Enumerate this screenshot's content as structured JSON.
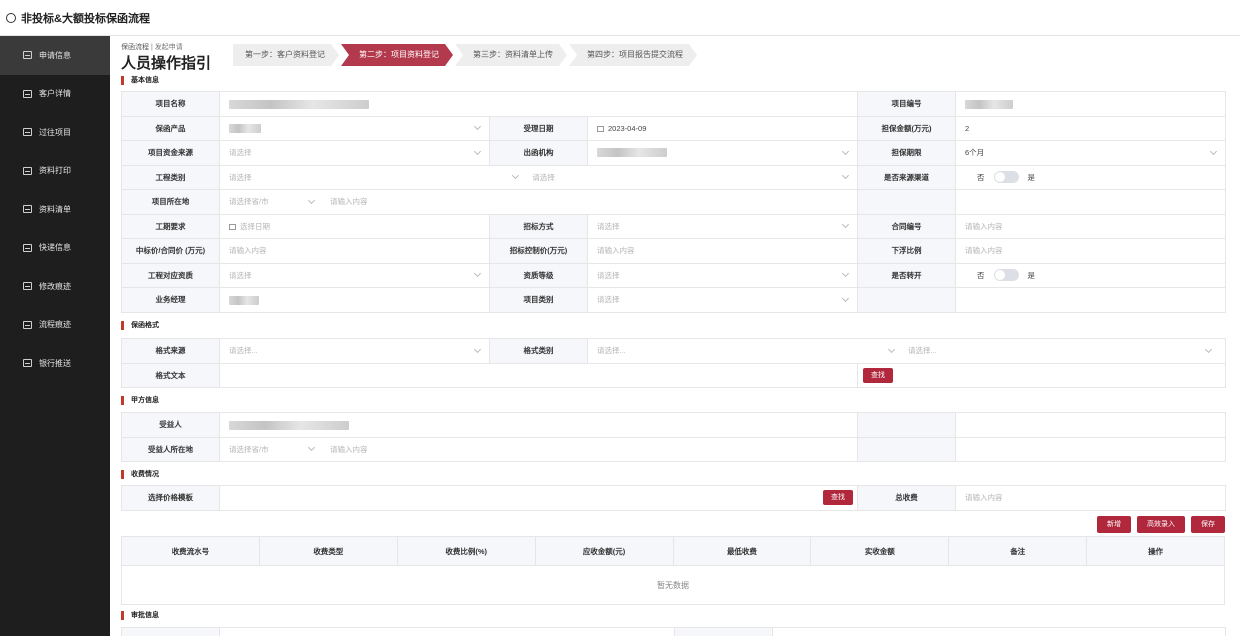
{
  "app": {
    "title": "非投标&大额投标保函流程"
  },
  "sidebar": {
    "items": [
      {
        "label": "申请信息",
        "active": true
      },
      {
        "label": "客户详情"
      },
      {
        "label": "过往项目"
      },
      {
        "label": "资料打印"
      },
      {
        "label": "资料清单"
      },
      {
        "label": "快递信息"
      },
      {
        "label": "修改痕迹"
      },
      {
        "label": "流程痕迹"
      },
      {
        "label": "银行推送"
      }
    ]
  },
  "breadcrumb": {
    "part1": "保函流程",
    "sep": "|",
    "part2": "发起申请"
  },
  "page_title": "人员操作指引",
  "steps": [
    {
      "label": "第一步：客户资料登记"
    },
    {
      "label": "第二步：项目资料登记",
      "active": true
    },
    {
      "label": "第三步：资料清单上传"
    },
    {
      "label": "第四步：项目报告提交流程"
    }
  ],
  "sections": {
    "basic": "基本信息",
    "format": "保函格式",
    "party": "甲方信息",
    "fee": "收费情况",
    "approval": "审批信息"
  },
  "basic": {
    "project_name_label": "项目名称",
    "project_no_label": "项目编号",
    "product_label": "保函产品",
    "accept_date_label": "受理日期",
    "accept_date": "2023-04-09",
    "guarantee_amount_label": "担保金额(万元)",
    "guarantee_amount": "2",
    "fund_source_label": "项目资金来源",
    "fund_source_ph": "请选择",
    "issuer_label": "出函机构",
    "guarantee_period_label": "担保期限",
    "guarantee_period": "6个月",
    "eng_type_label": "工程类别",
    "eng_type_ph1": "请选择",
    "eng_type_ph2": "请选择",
    "source_channel_label": "是否来源渠道",
    "no": "否",
    "yes": "是",
    "location_label": "项目所在地",
    "province_ph": "请选择省/市",
    "detail_ph": "请输入内容",
    "duration_label": "工期要求",
    "date_ph": "选择日期",
    "bid_method_label": "招标方式",
    "select_ph": "请选择",
    "contract_no_label": "合同编号",
    "input_ph": "请输入内容",
    "bid_price_label": "中标价/合同价 (万元)",
    "control_price_label": "招标控制价(万元)",
    "float_ratio_label": "下浮比例",
    "qualification_label": "工程对应资质",
    "qual_level_label": "资质等级",
    "subcontract_label": "是否转开",
    "manager_label": "业务经理",
    "project_category_label": "项目类别"
  },
  "format": {
    "source_label": "格式来源",
    "source_ph": "请选择...",
    "category_label": "格式类别",
    "category_ph1": "请选择...",
    "category_ph2": "请选择...",
    "text_label": "格式文本",
    "search_btn": "查找"
  },
  "party": {
    "beneficiary_label": "受益人",
    "beneficiary_loc_label": "受益人所在地",
    "province_ph": "请选择省/市",
    "detail_ph": "请输入内容"
  },
  "fee": {
    "template_label": "选择价格模板",
    "search_btn": "查找",
    "total_label": "总收费",
    "total_ph": "请输入内容",
    "add_btn": "新增",
    "batch_btn": "高效录入",
    "save_btn": "保存",
    "columns": [
      "收费流水号",
      "收费类型",
      "收费比例(%)",
      "应收金额(元)",
      "最低收费",
      "实收金额",
      "备注",
      "操作"
    ],
    "empty_text": "暂无数据"
  }
}
